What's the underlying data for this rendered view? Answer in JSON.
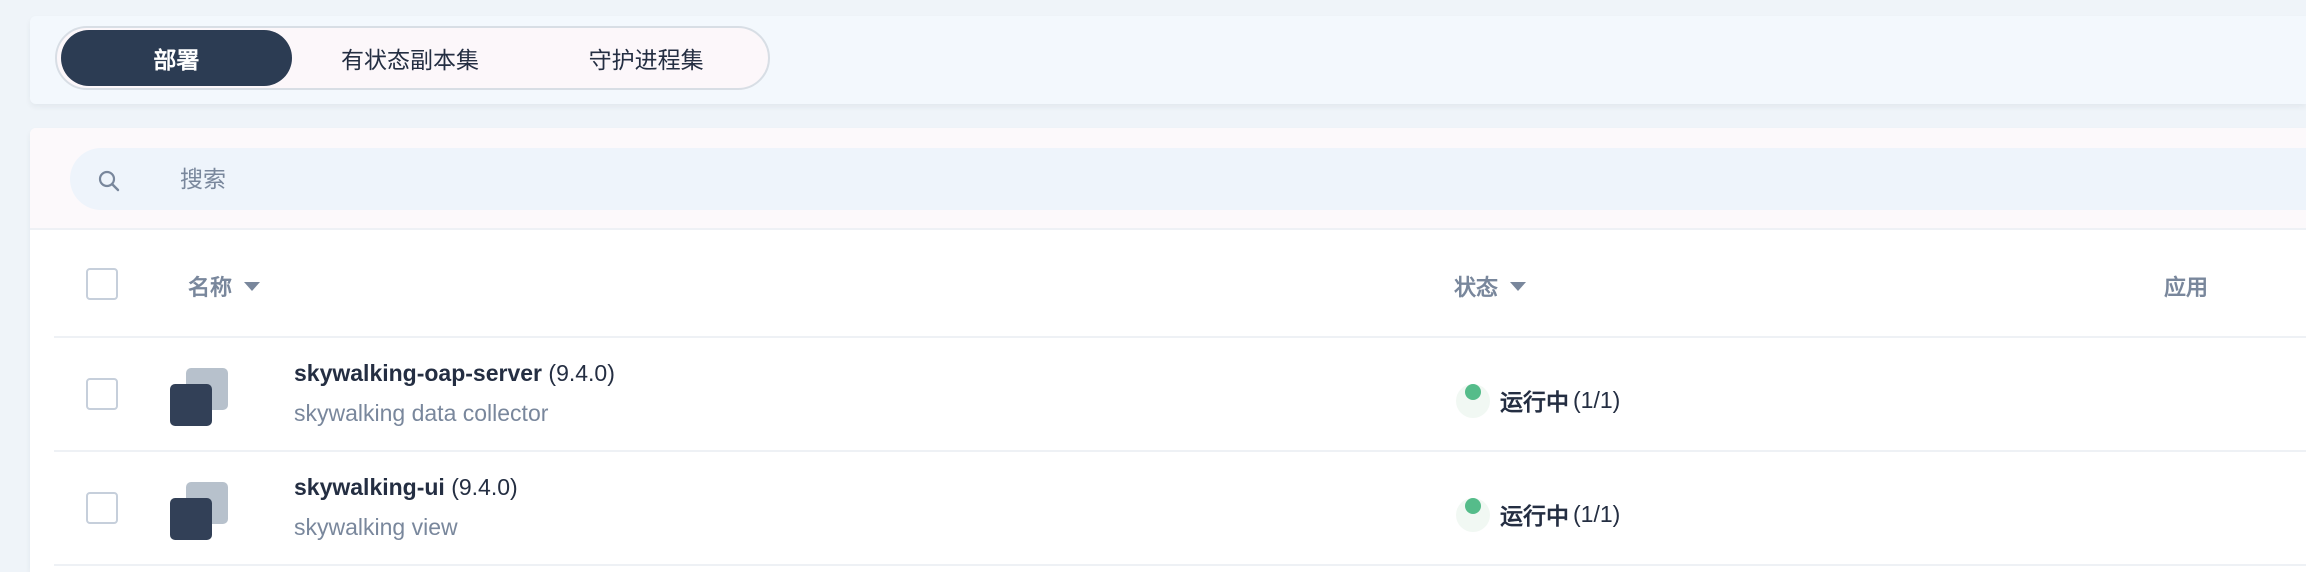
{
  "tabs": [
    {
      "label": "部署",
      "active": true
    },
    {
      "label": "有状态副本集",
      "active": false
    },
    {
      "label": "守护进程集",
      "active": false
    }
  ],
  "search": {
    "placeholder": "搜索"
  },
  "table": {
    "columns": {
      "name": "名称",
      "status": "状态",
      "app": "应用"
    },
    "rows": [
      {
        "name": "skywalking-oap-server",
        "version": "(9.4.0)",
        "description": "skywalking data collector",
        "status": "运行中",
        "count": "(1/1)"
      },
      {
        "name": "skywalking-ui",
        "version": "(9.4.0)",
        "description": "skywalking view",
        "status": "运行中",
        "count": "(1/1)"
      }
    ]
  },
  "colors": {
    "accent": "#2c3c53",
    "running": "#55bc8a",
    "muted": "#79879c"
  }
}
